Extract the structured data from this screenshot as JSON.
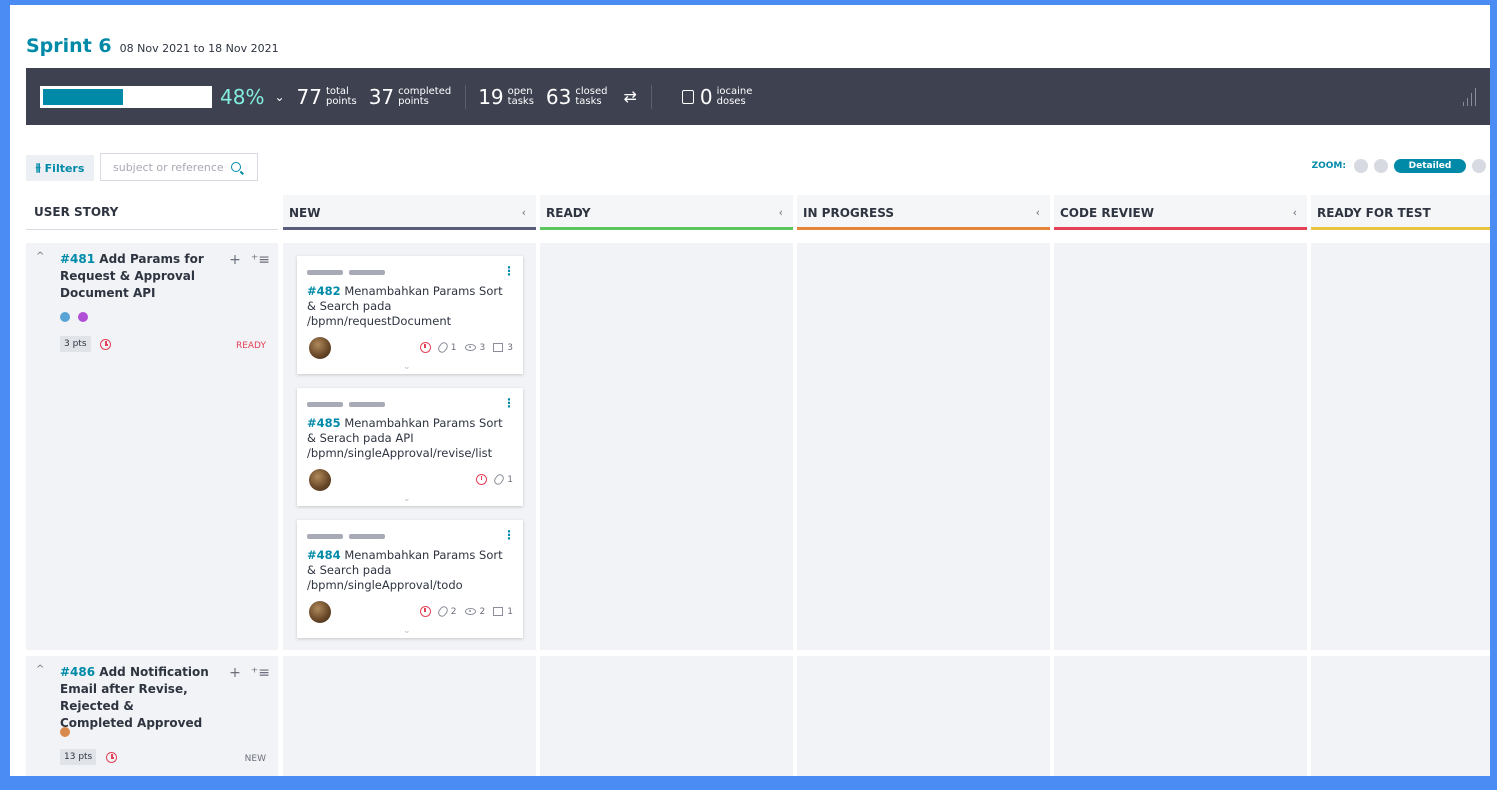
{
  "sprint": {
    "name": "Sprint 6",
    "dates": "08 Nov 2021 to 18 Nov 2021"
  },
  "stats": {
    "progress": 0.48,
    "percent": "48%",
    "total_points": "77",
    "total_points_label_1": "total",
    "total_points_label_2": "points",
    "completed_points": "37",
    "completed_label_1": "completed",
    "completed_label_2": "points",
    "open_tasks": "19",
    "open_label_1": "open",
    "open_label_2": "tasks",
    "closed_tasks": "63",
    "closed_label_1": "closed",
    "closed_label_2": "tasks",
    "iocaine": "0",
    "iocaine_label_1": "iocaine",
    "iocaine_label_2": "doses"
  },
  "filters": {
    "label": "Filters",
    "search_placeholder": "subject or reference"
  },
  "zoom": {
    "label": "ZOOM:",
    "active": "Detailed"
  },
  "columns": {
    "user_story": "USER STORY",
    "list": [
      {
        "label": "NEW",
        "color": "#5b5e7a"
      },
      {
        "label": "READY",
        "color": "#5bc65b"
      },
      {
        "label": "IN PROGRESS",
        "color": "#e6843a"
      },
      {
        "label": "CODE REVIEW",
        "color": "#e44057"
      },
      {
        "label": "READY FOR TEST",
        "color": "#e8c440"
      }
    ]
  },
  "stories": [
    {
      "ref": "#481",
      "title": "Add Params for Request & Approval Document API",
      "dots": [
        "#5aa3d6",
        "#b04fd6"
      ],
      "points": "3 pts",
      "status": "READY",
      "status_color": "#e44057",
      "cards": [
        {
          "ref": "#482",
          "title": "Menambahkan Params Sort & Search pada /bpmn/requestDocument",
          "attachments": "1",
          "watchers": "3",
          "comments": "3"
        },
        {
          "ref": "#485",
          "title": "Menambahkan Params Sort & Serach pada API /bpmn/singleApproval/revise/list",
          "attachments": "1"
        },
        {
          "ref": "#484",
          "title": "Menambahkan Params Sort & Search pada /bpmn/singleApproval/todo",
          "attachments": "2",
          "watchers": "2",
          "comments": "1"
        }
      ]
    },
    {
      "ref": "#486",
      "title": "Add Notification Email after Revise, Rejected & Completed Approved",
      "dots": [
        "#d88a4e"
      ],
      "points": "13 pts",
      "status": "NEW",
      "status_color": "#6b6f7c"
    }
  ]
}
